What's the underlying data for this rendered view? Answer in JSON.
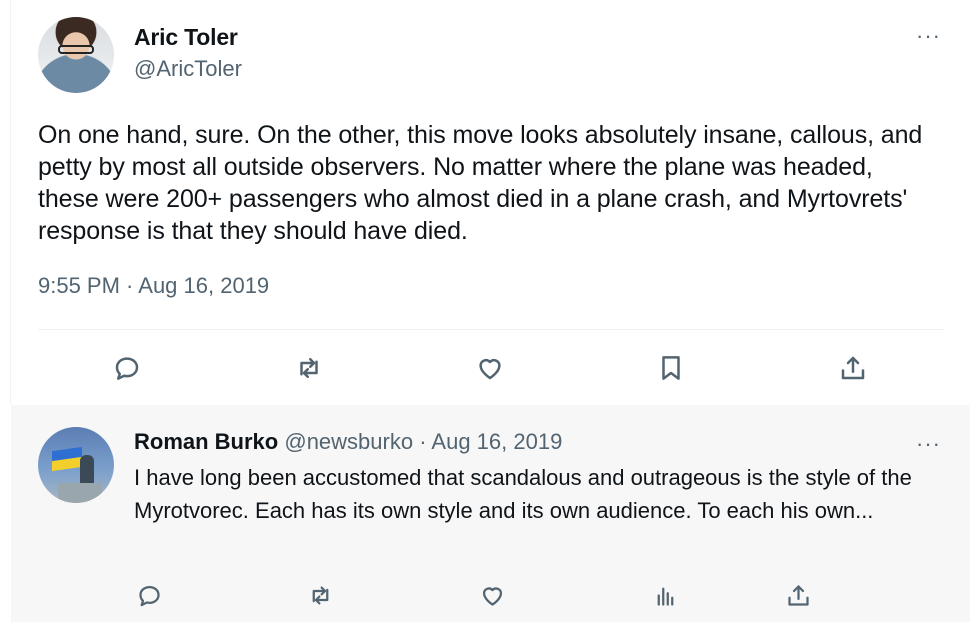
{
  "main_tweet": {
    "author_name": "Aric Toler",
    "author_handle": "@AricToler",
    "more_label": "···",
    "text": "On one hand, sure. On the other, this move looks absolutely insane, callous, and petty by most all outside observers. No matter where the plane was headed, these were 200+ passengers who almost died in a plane crash, and Myrtovrets' response is that they should have died.",
    "timestamp": "9:55 PM · Aug 16, 2019",
    "actions": [
      "reply-icon",
      "retweet-icon",
      "like-icon",
      "bookmark-icon",
      "share-icon"
    ]
  },
  "reply_tweet": {
    "author_name": "Roman Burko",
    "author_meta": " @newsburko · Aug 16, 2019",
    "more_label": "···",
    "text": "I have long been accustomed that scandalous and outrageous is the style of the Myrotvorec. Each has its own style and its own audience. To each his own...",
    "actions": [
      "reply-icon",
      "retweet-icon",
      "like-icon",
      "views-icon",
      "share-icon"
    ]
  },
  "colors": {
    "text_primary": "#0f1419",
    "text_secondary": "#536471",
    "divider": "#eff3f4",
    "reply_background": "#f7f7f7"
  }
}
